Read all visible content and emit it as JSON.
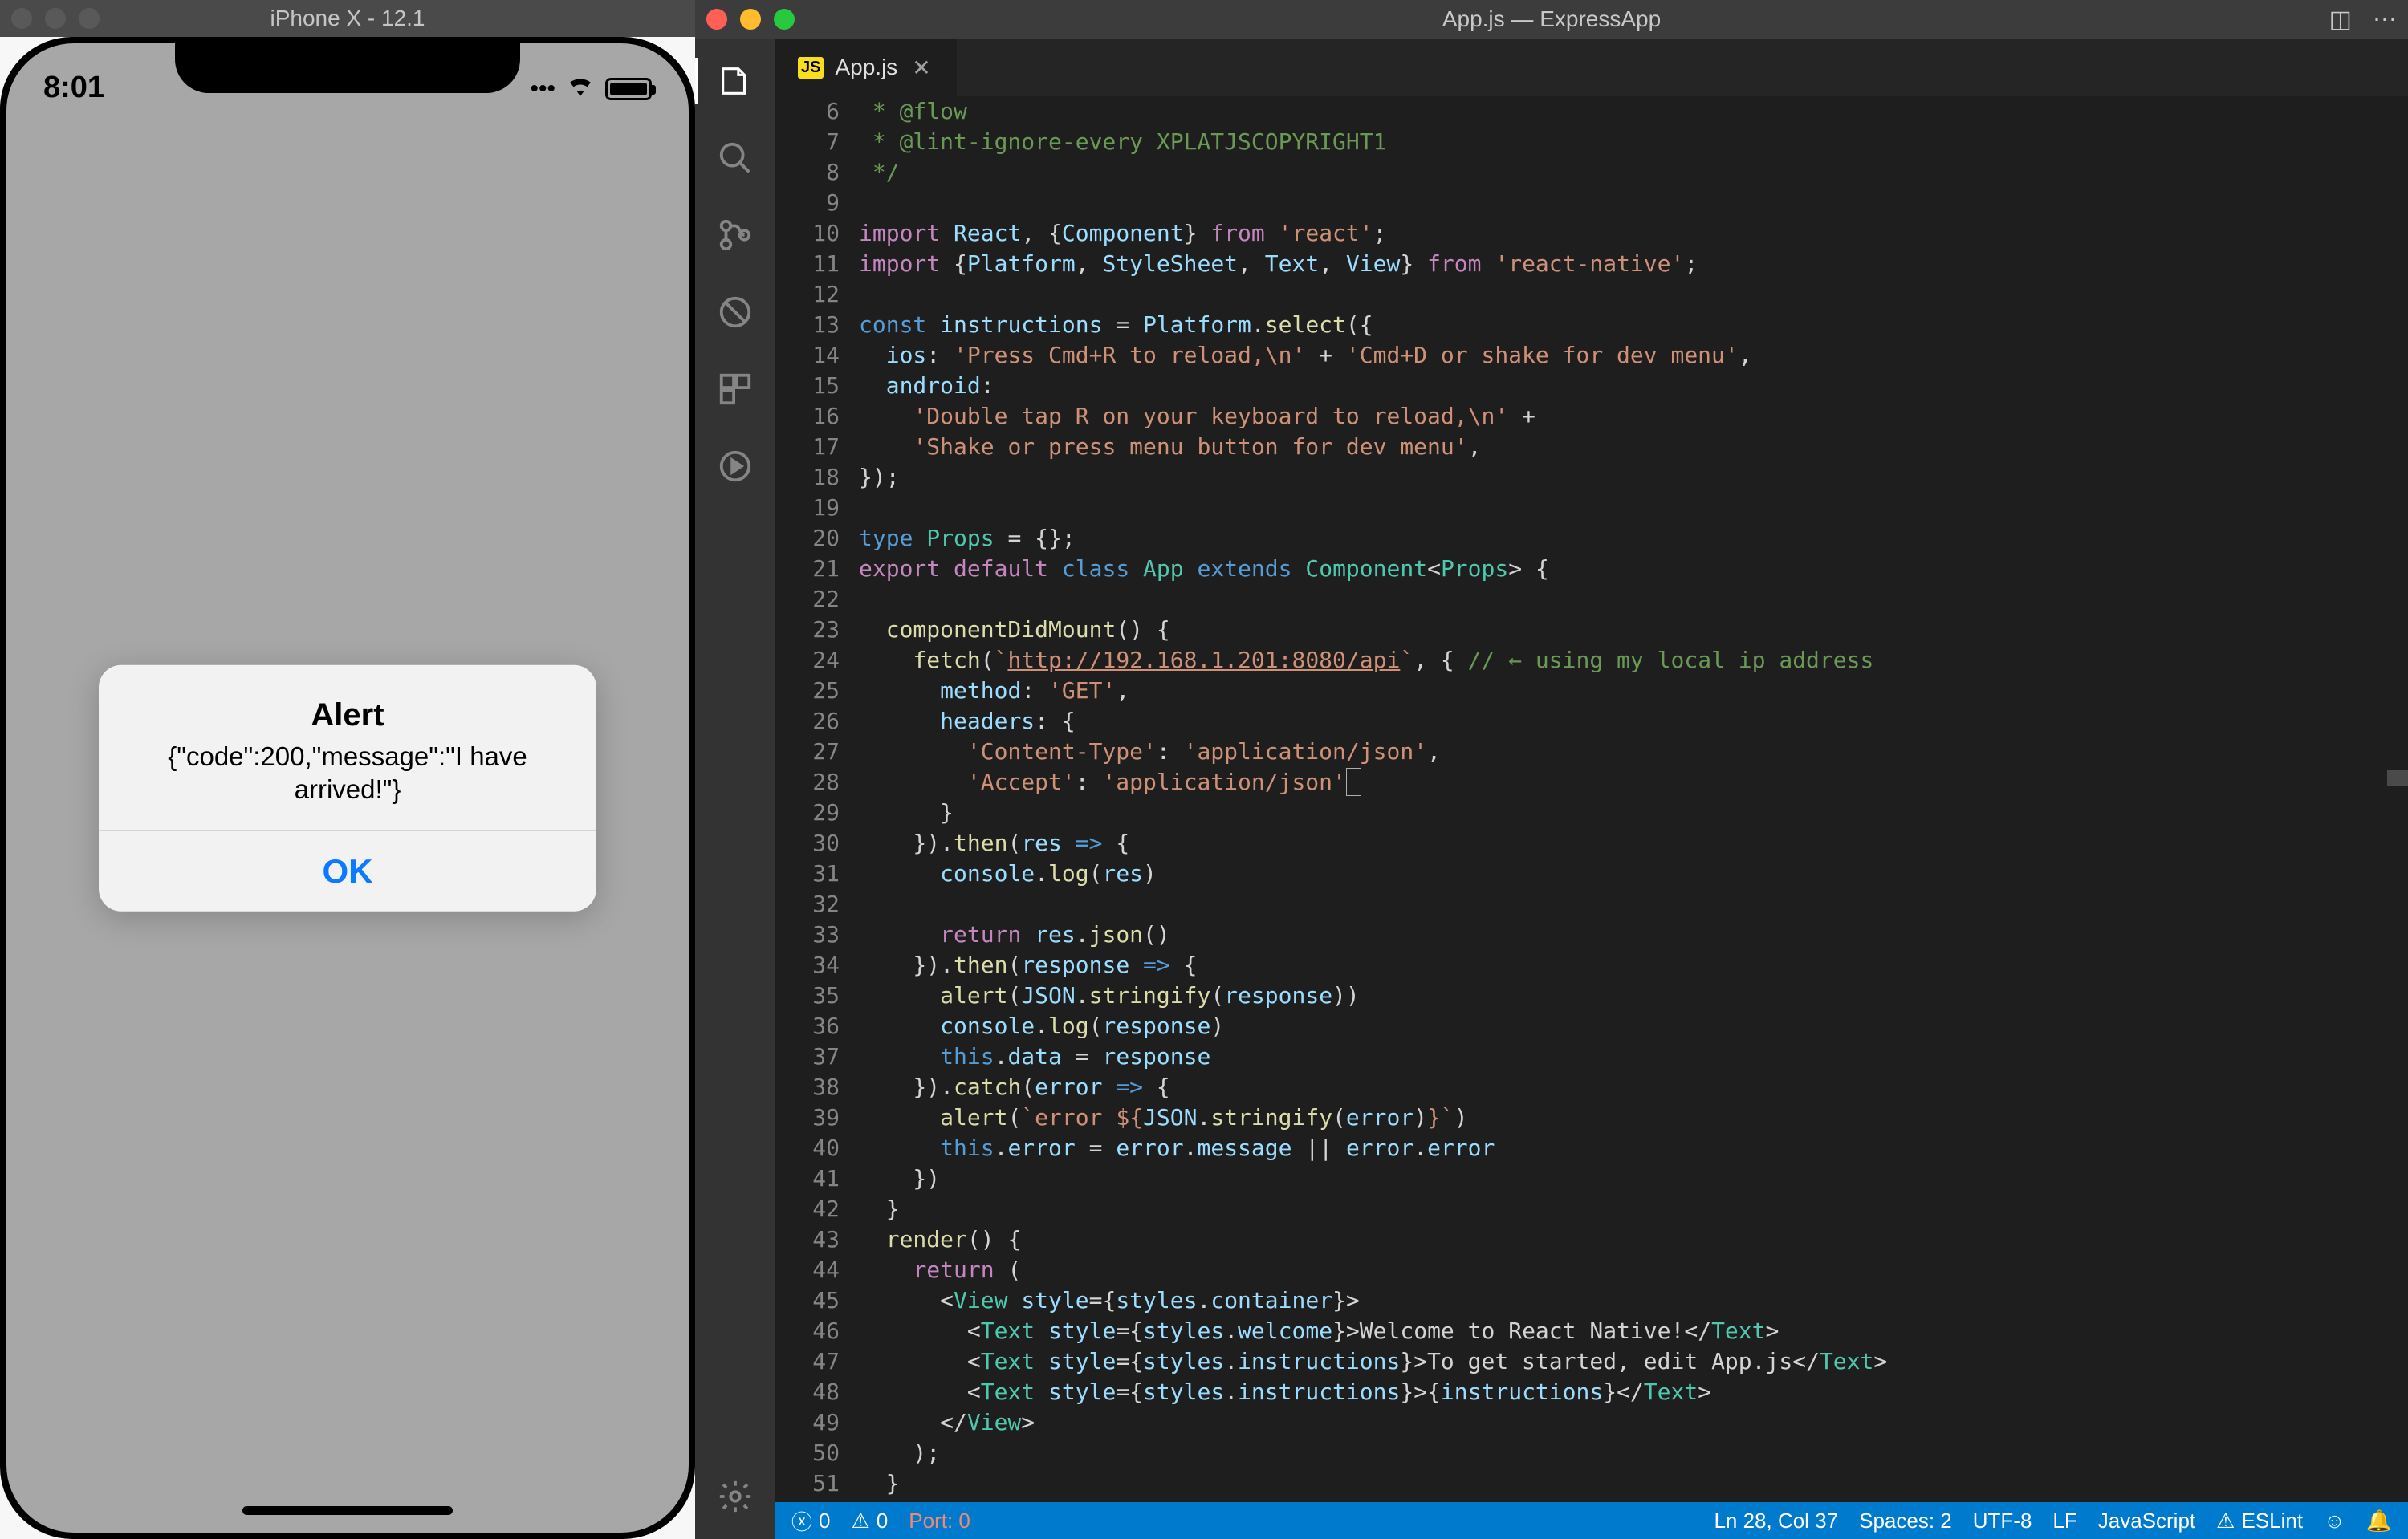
{
  "simulator": {
    "title": "iPhone X - 12.1",
    "time": "8:01",
    "alert": {
      "title": "Alert",
      "message": "{\"code\":200,\"message\":\"I have arrived!\"}",
      "ok": "OK"
    }
  },
  "vscode": {
    "title": "App.js — ExpressApp",
    "tab": "App.js",
    "tab_badge": "JS",
    "status": {
      "errors": "0",
      "warnings": "0",
      "port": "Port: 0",
      "cursor": "Ln 28, Col 37",
      "spaces": "Spaces: 2",
      "enc": "UTF-8",
      "eol": "LF",
      "lang": "JavaScript",
      "lint": "ESLint"
    },
    "lines": [
      {
        "n": 6,
        "h": "<span class='c-cm'> * @flow</span>"
      },
      {
        "n": 7,
        "h": "<span class='c-cm'> * @lint-ignore-every XPLATJSCOPYRIGHT1</span>"
      },
      {
        "n": 8,
        "h": "<span class='c-cm'> */</span>"
      },
      {
        "n": 9,
        "h": ""
      },
      {
        "n": 10,
        "h": "<span class='c-kw'>import</span> <span class='c-vr'>React</span>, {<span class='c-vr'>Component</span>} <span class='c-kw'>from</span> <span class='c-str'>'react'</span>;"
      },
      {
        "n": 11,
        "h": "<span class='c-kw'>import</span> {<span class='c-vr'>Platform</span>, <span class='c-vr'>StyleSheet</span>, <span class='c-vr'>Text</span>, <span class='c-vr'>View</span>} <span class='c-kw'>from</span> <span class='c-str'>'react-native'</span>;"
      },
      {
        "n": 12,
        "h": ""
      },
      {
        "n": 13,
        "h": "<span class='c-st'>const</span> <span class='c-vr'>instructions</span> = <span class='c-vr'>Platform</span>.<span class='c-fn'>select</span>({"
      },
      {
        "n": 14,
        "h": "  <span class='c-vr'>ios</span>: <span class='c-str'>'Press Cmd+R to reload,\\n'</span> + <span class='c-str'>'Cmd+D or shake for dev menu'</span>,"
      },
      {
        "n": 15,
        "h": "  <span class='c-vr'>android</span>:"
      },
      {
        "n": 16,
        "h": "    <span class='c-str'>'Double tap R on your keyboard to reload,\\n'</span> +"
      },
      {
        "n": 17,
        "h": "    <span class='c-str'>'Shake or press menu button for dev menu'</span>,"
      },
      {
        "n": 18,
        "h": "});"
      },
      {
        "n": 19,
        "h": ""
      },
      {
        "n": 20,
        "h": "<span class='c-st'>type</span> <span class='c-ty'>Props</span> = {};"
      },
      {
        "n": 21,
        "h": "<span class='c-kw'>export</span> <span class='c-kw'>default</span> <span class='c-st'>class</span> <span class='c-ty'>App</span> <span class='c-st'>extends</span> <span class='c-ty'>Component</span>&lt;<span class='c-ty'>Props</span>&gt; {"
      },
      {
        "n": 22,
        "h": ""
      },
      {
        "n": 23,
        "h": "  <span class='c-fn'>componentDidMount</span>() {"
      },
      {
        "n": 24,
        "h": "    <span class='c-fn'>fetch</span>(<span class='c-str'>`</span><span class='c-url'>http://192.168.1.201:8080/api</span><span class='c-str'>`</span>, { <span class='c-cm'>// ← using my local ip address</span>"
      },
      {
        "n": 25,
        "h": "      <span class='c-vr'>method</span>: <span class='c-str'>'GET'</span>,"
      },
      {
        "n": 26,
        "h": "      <span class='c-vr'>headers</span>: {"
      },
      {
        "n": 27,
        "h": "        <span class='c-str'>'Content-Type'</span>: <span class='c-str'>'application/json'</span>,"
      },
      {
        "n": 28,
        "h": "        <span class='c-str'>'Accept'</span>: <span class='c-str'>'application/json'</span><span style='border:1px solid #aeafad'>&nbsp;</span>"
      },
      {
        "n": 29,
        "h": "      }"
      },
      {
        "n": 30,
        "h": "    }).<span class='c-fn'>then</span>(<span class='c-vr'>res</span> <span class='c-st'>=&gt;</span> {"
      },
      {
        "n": 31,
        "h": "      <span class='c-vr'>console</span>.<span class='c-fn'>log</span>(<span class='c-vr'>res</span>)"
      },
      {
        "n": 32,
        "h": ""
      },
      {
        "n": 33,
        "h": "      <span class='c-kw'>return</span> <span class='c-vr'>res</span>.<span class='c-fn'>json</span>()"
      },
      {
        "n": 34,
        "h": "    }).<span class='c-fn'>then</span>(<span class='c-vr'>response</span> <span class='c-st'>=&gt;</span> {"
      },
      {
        "n": 35,
        "h": "      <span class='c-fn'>alert</span>(<span class='c-vr'>JSON</span>.<span class='c-fn'>stringify</span>(<span class='c-vr'>response</span>))"
      },
      {
        "n": 36,
        "h": "      <span class='c-vr'>console</span>.<span class='c-fn'>log</span>(<span class='c-vr'>response</span>)"
      },
      {
        "n": 37,
        "h": "      <span class='c-st'>this</span>.<span class='c-vr'>data</span> = <span class='c-vr'>response</span>"
      },
      {
        "n": 38,
        "h": "    }).<span class='c-fn'>catch</span>(<span class='c-vr'>error</span> <span class='c-st'>=&gt;</span> {"
      },
      {
        "n": 39,
        "h": "      <span class='c-fn'>alert</span>(<span class='c-str'>`error ${</span><span class='c-vr'>JSON</span>.<span class='c-fn'>stringify</span>(<span class='c-vr'>error</span>)<span class='c-str'>}`</span>)"
      },
      {
        "n": 40,
        "h": "      <span class='c-st'>this</span>.<span class='c-vr'>error</span> = <span class='c-vr'>error</span>.<span class='c-vr'>message</span> || <span class='c-vr'>error</span>.<span class='c-vr'>error</span>"
      },
      {
        "n": 41,
        "h": "    })"
      },
      {
        "n": 42,
        "h": "  }"
      },
      {
        "n": 43,
        "h": "  <span class='c-fn'>render</span>() {"
      },
      {
        "n": 44,
        "h": "    <span class='c-kw'>return</span> ("
      },
      {
        "n": 45,
        "h": "      &lt;<span class='c-ty'>View</span> <span class='c-vr'>style</span>={<span class='c-vr'>styles</span>.<span class='c-vr'>container</span>}&gt;"
      },
      {
        "n": 46,
        "h": "        &lt;<span class='c-ty'>Text</span> <span class='c-vr'>style</span>={<span class='c-vr'>styles</span>.<span class='c-vr'>welcome</span>}&gt;Welcome to React Native!&lt;/<span class='c-ty'>Text</span>&gt;"
      },
      {
        "n": 47,
        "h": "        &lt;<span class='c-ty'>Text</span> <span class='c-vr'>style</span>={<span class='c-vr'>styles</span>.<span class='c-vr'>instructions</span>}&gt;To get started, edit App.js&lt;/<span class='c-ty'>Text</span>&gt;"
      },
      {
        "n": 48,
        "h": "        &lt;<span class='c-ty'>Text</span> <span class='c-vr'>style</span>={<span class='c-vr'>styles</span>.<span class='c-vr'>instructions</span>}&gt;{<span class='c-vr'>instructions</span>}&lt;/<span class='c-ty'>Text</span>&gt;"
      },
      {
        "n": 49,
        "h": "      &lt;/<span class='c-ty'>View</span>&gt;"
      },
      {
        "n": 50,
        "h": "    );"
      },
      {
        "n": 51,
        "h": "  }"
      }
    ]
  }
}
